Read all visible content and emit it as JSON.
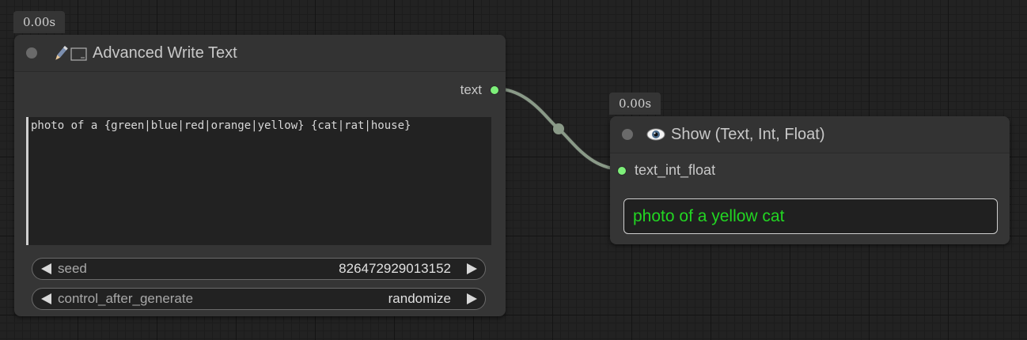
{
  "node1": {
    "time_badge": "0.00s",
    "icon": "pen-icon",
    "title": "Advanced Write Text",
    "output_label": "text",
    "text_value": "photo of a {green|blue|red|orange|yellow} {cat|rat|house}",
    "widgets": [
      {
        "label": "seed",
        "value": "826472929013152"
      },
      {
        "label": "control_after_generate",
        "value": "randomize"
      }
    ]
  },
  "node2": {
    "time_badge": "0.00s",
    "icon": "eye-icon",
    "title": "Show (Text, Int, Float)",
    "input_label": "text_int_float",
    "display_value": "photo of a yellow cat"
  },
  "colors": {
    "slot": "#7ef07a",
    "link": "#8a9a88",
    "display_text": "#22d622"
  }
}
